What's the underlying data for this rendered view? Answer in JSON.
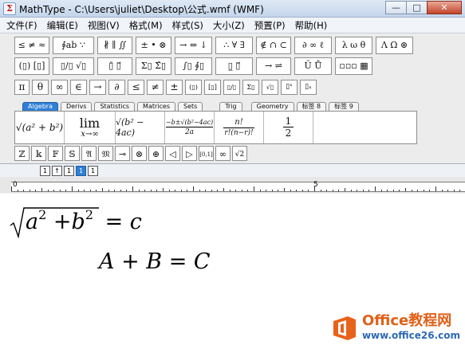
{
  "window": {
    "title": "MathType - C:\\Users\\juliet\\Desktop\\公式.wmf (WMF)",
    "icon_glyph": "Σ",
    "minimize": "—",
    "maximize": "□",
    "close": "✕"
  },
  "menu": [
    "文件(F)",
    "编辑(E)",
    "视图(V)",
    "格式(M)",
    "样式(S)",
    "大小(Z)",
    "预置(P)",
    "帮助(H)"
  ],
  "symbol_row1": [
    "≤ ≠ ≈",
    "∮ab ∵",
    "∦ ∥ ∬",
    "± • ⊗",
    "→ ⇔ ↓",
    "∴ ∀ ∃",
    "∉ ∩ ⊂",
    "∂ ∞ ℓ",
    "λ ω θ",
    "Λ Ω ⊛"
  ],
  "symbol_row2": [
    "(▯) [▯]",
    "▯/▯ √▯",
    "▯̄ ▯⃗",
    "Σ▯ Σ̂▯",
    "∫▯ ∮▯",
    "▯̲ ▯⃗",
    "→ ⇌",
    "Ũ Ů",
    "▫▫▫ ▦"
  ],
  "symbol_row3": [
    "π",
    "θ",
    "∞",
    "∈",
    "→",
    "∂",
    "≤",
    "≠",
    "±",
    "(▯)",
    "[▯]",
    "▯/▯",
    "Σ▯",
    "√▯",
    "▯ˣ",
    "▯ₓ"
  ],
  "tabs": [
    {
      "label": "Algebra",
      "active": true
    },
    {
      "label": "Derivs",
      "active": false
    },
    {
      "label": "Statistics",
      "active": false
    },
    {
      "label": "Matrices",
      "active": false
    },
    {
      "label": "Sets",
      "active": false
    },
    {
      "label": "Trig",
      "active": false
    },
    {
      "label": "Geometry",
      "active": false
    },
    {
      "label": "标签 8",
      "active": false
    },
    {
      "label": "标签 9",
      "active": false
    }
  ],
  "templates": {
    "sqrt_sum": "√(a² + b²)",
    "lim_top": "lim",
    "lim_bottom": "x→∞",
    "sqrt_disc": "√(b² − 4ac)",
    "quad_num": "−b±√(b²−4ac)",
    "quad_den": "2a",
    "binom_num": "n!",
    "binom_den": "r!(n−r)!",
    "half_num": "1",
    "half_den": "2"
  },
  "symbol_row5": [
    "ℤ",
    "𝕜",
    "𝔽",
    "𝕊",
    "𝔄",
    "𝔐",
    "⊸",
    "⊗",
    "⊕",
    "◁",
    "▷",
    "[0,1]",
    "∞",
    "√2"
  ],
  "mini_buttons": [
    "1",
    "↑",
    "1",
    "1",
    "1"
  ],
  "ruler": {
    "left": "0",
    "mid": "5"
  },
  "document": {
    "eq1_a": "a",
    "eq1_exp1": "2",
    "eq1_plus": "+",
    "eq1_b": "b",
    "eq1_exp2": "2",
    "eq1_rhs": "= c",
    "eq2": "A + B = C"
  },
  "watermark": {
    "main": "Office教程网",
    "url": "www.office26.com"
  }
}
